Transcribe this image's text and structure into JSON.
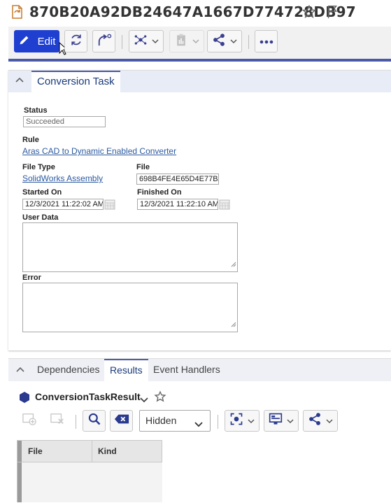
{
  "header": {
    "title": "870B20A92DB24647A1667D774728DB97"
  },
  "toolbar": {
    "edit_label": "Edit"
  },
  "form": {
    "tab_label": "Conversion Task",
    "status_label": "Status",
    "status_value": "Succeeded",
    "rule_label": "Rule",
    "rule_value": "Aras CAD to Dynamic Enabled Converter",
    "file_type_label": "File Type",
    "file_type_value": "SolidWorks Assembly",
    "file_label": "File",
    "file_value": "698B4FE4E65D4E77BA",
    "started_on_label": "Started On",
    "started_on_value": "12/3/2021 11:22:02 AM",
    "finished_on_label": "Finished On",
    "finished_on_value": "12/3/2021 11:22:10 AM",
    "user_data_label": "User Data",
    "error_label": "Error"
  },
  "relationships": {
    "tabs": [
      "Dependencies",
      "Results",
      "Event Handlers"
    ],
    "active_tab": "Results",
    "item_type": "ConversionTaskResult",
    "view_select": "Hidden",
    "grid_columns": [
      "File",
      "Kind"
    ]
  },
  "colors": {
    "accent": "#4a5aa8",
    "edit_button": "#1f3fd1",
    "link": "#2c5aa0"
  }
}
